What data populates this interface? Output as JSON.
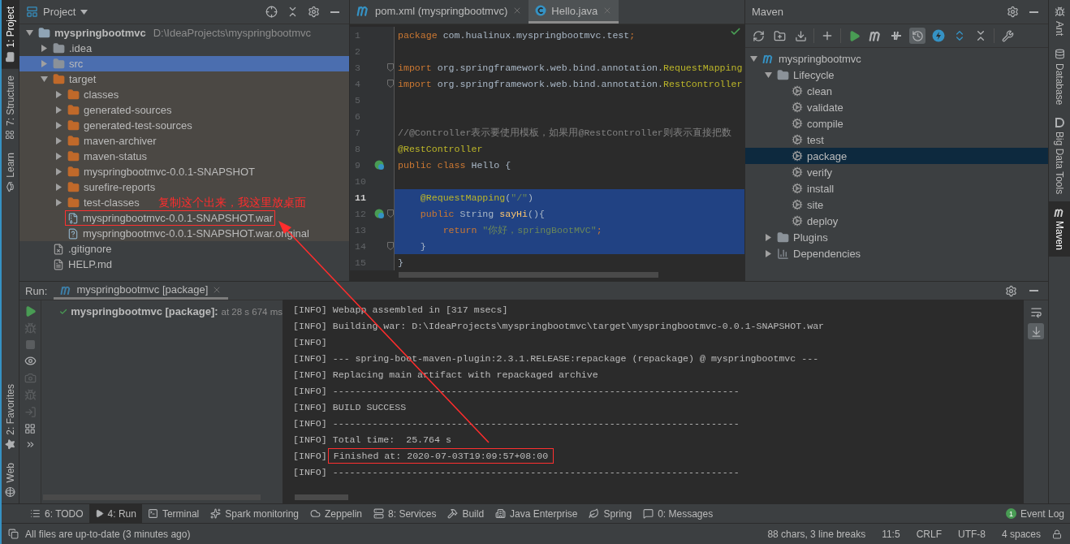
{
  "left_strip": {
    "top": [
      {
        "label": "1: Project",
        "kind": "project",
        "selected": true
      },
      {
        "label": "7: Structure",
        "kind": "structure",
        "selected": false
      },
      {
        "label": "Learn",
        "kind": "learn",
        "selected": false
      }
    ],
    "bottom": [
      {
        "label": "2: Favorites",
        "kind": "favorites",
        "selected": false
      },
      {
        "label": "Web",
        "kind": "web",
        "selected": false
      }
    ]
  },
  "project_panel": {
    "title": "Project",
    "tree": [
      {
        "name": "myspringbootmvc",
        "path": "D:\\IdeaProjects\\myspringbootmvc",
        "kind": "module",
        "expanded": true,
        "selected": false,
        "excluded": false,
        "children": [
          {
            "name": ".idea",
            "kind": "folder",
            "expanded": false,
            "selected": false,
            "excluded": false
          },
          {
            "name": "src",
            "kind": "folder",
            "expanded": false,
            "selected": true,
            "excluded": false
          },
          {
            "name": "target",
            "kind": "excluded-folder",
            "expanded": true,
            "selected": false,
            "excluded": true,
            "children": [
              {
                "name": "classes",
                "kind": "excluded-folder",
                "expanded": false,
                "selected": false,
                "excluded": true
              },
              {
                "name": "generated-sources",
                "kind": "excluded-folder",
                "expanded": false,
                "selected": false,
                "excluded": true
              },
              {
                "name": "generated-test-sources",
                "kind": "excluded-folder",
                "expanded": false,
                "selected": false,
                "excluded": true
              },
              {
                "name": "maven-archiver",
                "kind": "excluded-folder",
                "expanded": false,
                "selected": false,
                "excluded": true
              },
              {
                "name": "maven-status",
                "kind": "excluded-folder",
                "expanded": false,
                "selected": false,
                "excluded": true
              },
              {
                "name": "myspringbootmvc-0.0.1-SNAPSHOT",
                "kind": "excluded-folder",
                "expanded": false,
                "selected": false,
                "excluded": true
              },
              {
                "name": "surefire-reports",
                "kind": "excluded-folder",
                "expanded": false,
                "selected": false,
                "excluded": true
              },
              {
                "name": "test-classes",
                "kind": "excluded-folder",
                "expanded": false,
                "selected": false,
                "excluded": true,
                "note": "复制这个出来，我这里放桌面"
              },
              {
                "name": "myspringbootmvc-0.0.1-SNAPSHOT.war",
                "kind": "archive",
                "selected": false,
                "excluded": true,
                "boxed": true
              },
              {
                "name": "myspringbootmvc-0.0.1-SNAPSHOT.war.original",
                "kind": "unknown-file",
                "selected": false,
                "excluded": true
              }
            ]
          },
          {
            "name": ".gitignore",
            "kind": "ignore-file",
            "selected": false,
            "excluded": false
          },
          {
            "name": "HELP.md",
            "kind": "text-file",
            "selected": false,
            "excluded": false
          }
        ]
      }
    ]
  },
  "editor": {
    "tabs": [
      {
        "label": "pom.xml (myspringbootmvc)",
        "kind": "maven",
        "selected": false
      },
      {
        "label": "Hello.java",
        "kind": "class",
        "selected": true
      }
    ],
    "lines": [
      {
        "number": "1",
        "current": false,
        "selected": false,
        "bean": false,
        "fold": false,
        "tokens": [
          {
            "text": "package",
            "kind": "keyword"
          },
          {
            "text": " com.hualinux.myspringbootmvc.test",
            "kind": "plain"
          },
          {
            "text": ";",
            "kind": "keyword"
          }
        ]
      },
      {
        "number": "2",
        "current": false,
        "selected": false,
        "bean": false,
        "fold": false
      },
      {
        "number": "3",
        "current": false,
        "selected": false,
        "bean": false,
        "fold": true,
        "tokens": [
          {
            "text": "import",
            "kind": "keyword"
          },
          {
            "text": " org.springframework.web.bind.annotation.",
            "kind": "plain"
          },
          {
            "text": "RequestMapping",
            "kind": "annotation"
          }
        ]
      },
      {
        "number": "4",
        "current": false,
        "selected": false,
        "bean": false,
        "fold": true,
        "tokens": [
          {
            "text": "import",
            "kind": "keyword"
          },
          {
            "text": " org.springframework.web.bind.annotation.",
            "kind": "plain"
          },
          {
            "text": "RestController",
            "kind": "annotation"
          }
        ]
      },
      {
        "number": "5",
        "current": false,
        "selected": false,
        "bean": false,
        "fold": false
      },
      {
        "number": "6",
        "current": false,
        "selected": false,
        "bean": false,
        "fold": false
      },
      {
        "number": "7",
        "current": false,
        "selected": false,
        "bean": false,
        "fold": false,
        "tokens": [
          {
            "text": "//@Controller表示要使用模板，如果用@RestController则表示直接把数",
            "kind": "comment"
          }
        ]
      },
      {
        "number": "8",
        "current": false,
        "selected": false,
        "bean": false,
        "fold": false,
        "tokens": [
          {
            "text": "@RestController",
            "kind": "annotation"
          }
        ]
      },
      {
        "number": "9",
        "current": false,
        "selected": false,
        "bean": true,
        "fold": false,
        "tokens": [
          {
            "text": "public class",
            "kind": "keyword"
          },
          {
            "text": " Hello {",
            "kind": "plain"
          }
        ]
      },
      {
        "number": "10",
        "current": false,
        "selected": false,
        "bean": false,
        "fold": false
      },
      {
        "number": "11",
        "current": true,
        "selected": true,
        "bean": false,
        "fold": false,
        "tokens": [
          {
            "text": "    @RequestMapping",
            "kind": "annotation"
          },
          {
            "text": "(",
            "kind": "plain"
          },
          {
            "text": "\"/\"",
            "kind": "string"
          },
          {
            "text": ")",
            "kind": "plain"
          }
        ]
      },
      {
        "number": "12",
        "current": false,
        "selected": true,
        "bean": true,
        "fold": true,
        "tokens": [
          {
            "text": "    public",
            "kind": "keyword"
          },
          {
            "text": " String ",
            "kind": "plain"
          },
          {
            "text": "sayHi",
            "kind": "method"
          },
          {
            "text": "(){",
            "kind": "plain"
          }
        ]
      },
      {
        "number": "13",
        "current": false,
        "selected": true,
        "bean": false,
        "fold": false,
        "tokens": [
          {
            "text": "        return",
            "kind": "keyword"
          },
          {
            "text": " \"你好，springBootMVC\"",
            "kind": "string"
          },
          {
            "text": ";",
            "kind": "keyword"
          }
        ]
      },
      {
        "number": "14",
        "current": false,
        "selected": true,
        "bean": false,
        "fold": true,
        "tokens": [
          {
            "text": "    }",
            "kind": "plain"
          }
        ]
      },
      {
        "number": "15",
        "current": false,
        "selected": false,
        "bean": false,
        "fold": false,
        "tokens": [
          {
            "text": "}",
            "kind": "plain"
          }
        ]
      }
    ]
  },
  "maven": {
    "title": "Maven",
    "toolbar": [
      {
        "kind": "reload",
        "on": false
      },
      {
        "kind": "add-folder",
        "on": false
      },
      {
        "kind": "download",
        "on": false
      },
      {
        "kind": "add",
        "on": false
      },
      {
        "kind": "run",
        "on": false
      },
      {
        "kind": "maven",
        "on": false
      },
      {
        "kind": "toggle",
        "on": false
      },
      {
        "kind": "skip",
        "on": true
      },
      {
        "kind": "bolt",
        "on": false
      },
      {
        "kind": "expand",
        "on": false
      },
      {
        "kind": "collapse",
        "on": false
      },
      {
        "kind": "settings",
        "on": false
      }
    ],
    "tree": [
      {
        "name": "myspringbootmvc",
        "kind": "project",
        "expanded": true,
        "selected": false,
        "children": [
          {
            "name": "Lifecycle",
            "kind": "group",
            "expanded": true,
            "selected": false,
            "children": [
              {
                "name": "clean",
                "kind": "goal",
                "selected": false
              },
              {
                "name": "validate",
                "kind": "goal",
                "selected": false
              },
              {
                "name": "compile",
                "kind": "goal",
                "selected": false
              },
              {
                "name": "test",
                "kind": "goal",
                "selected": false
              },
              {
                "name": "package",
                "kind": "goal",
                "selected": true
              },
              {
                "name": "verify",
                "kind": "goal",
                "selected": false
              },
              {
                "name": "install",
                "kind": "goal",
                "selected": false
              },
              {
                "name": "site",
                "kind": "goal",
                "selected": false
              },
              {
                "name": "deploy",
                "kind": "goal",
                "selected": false
              }
            ]
          },
          {
            "name": "Plugins",
            "kind": "group",
            "expanded": false,
            "selected": false
          },
          {
            "name": "Dependencies",
            "kind": "deps",
            "expanded": false,
            "selected": false
          }
        ]
      }
    ]
  },
  "right_strip": [
    {
      "label": "Ant",
      "kind": "ant",
      "selected": false
    },
    {
      "label": "Database",
      "kind": "database",
      "selected": false
    },
    {
      "label": "Big Data Tools",
      "kind": "bigdata",
      "selected": false
    },
    {
      "label": "Maven",
      "kind": "maven",
      "selected": true
    }
  ],
  "run": {
    "label": "Run:",
    "tabs": [
      {
        "label": "myspringbootmvc [package]",
        "selected": true
      }
    ],
    "tree": [
      {
        "name": "myspringbootmvc [package]:",
        "time": "at 28 s 674 ms"
      }
    ],
    "console_toolbar": [
      {
        "kind": "soft-wrap",
        "on": false
      },
      {
        "kind": "scroll-to-end",
        "on": true
      }
    ],
    "console": [
      {
        "tag": "[INFO]",
        "text": "Webapp assembled in [317 msecs]"
      },
      {
        "tag": "[INFO]",
        "text": "Building war: D:\\IdeaProjects\\myspringbootmvc\\target\\myspringbootmvc-0.0.1-SNAPSHOT.war"
      },
      {
        "tag": "[INFO]"
      },
      {
        "tag": "[INFO]",
        "text": "--- spring-boot-maven-plugin:2.3.1.RELEASE:repackage (repackage) @ myspringbootmvc ---"
      },
      {
        "tag": "[INFO]",
        "text": "Replacing main artifact with repackaged archive"
      },
      {
        "tag": "[INFO]",
        "text": "------------------------------------------------------------------------"
      },
      {
        "tag": "[INFO]",
        "text": "BUILD SUCCESS"
      },
      {
        "tag": "[INFO]",
        "text": "------------------------------------------------------------------------"
      },
      {
        "tag": "[INFO]",
        "text": "Total time:  25.764 s"
      },
      {
        "tag": "[INFO]",
        "text": "Finished at: 2020-07-03T19:09:57+08:00",
        "boxed": true
      },
      {
        "tag": "[INFO]",
        "text": "------------------------------------------------------------------------"
      }
    ]
  },
  "tool_bar": {
    "items": [
      {
        "label": "6: TODO",
        "kind": "todo",
        "selected": false
      },
      {
        "label": "4: Run",
        "kind": "run",
        "selected": true
      },
      {
        "label": "Terminal",
        "kind": "terminal",
        "selected": false
      },
      {
        "label": "Spark monitoring",
        "kind": "spark",
        "selected": false
      },
      {
        "label": "Zeppelin",
        "kind": "zeppelin",
        "selected": false
      },
      {
        "label": "8: Services",
        "kind": "services",
        "selected": false
      },
      {
        "label": "Build",
        "kind": "build",
        "selected": false
      },
      {
        "label": "Java Enterprise",
        "kind": "enterprise",
        "selected": false
      },
      {
        "label": "Spring",
        "kind": "spring",
        "selected": false
      },
      {
        "label": "0: Messages",
        "kind": "messages",
        "selected": false
      }
    ],
    "event_log": {
      "count": "1",
      "label": "Event Log"
    }
  },
  "status_bar": {
    "message": "All files are up-to-date (3 minutes ago)",
    "items": [
      "88 chars, 3 line breaks",
      "11:5",
      "CRLF",
      "UTF-8",
      "4 spaces"
    ]
  }
}
